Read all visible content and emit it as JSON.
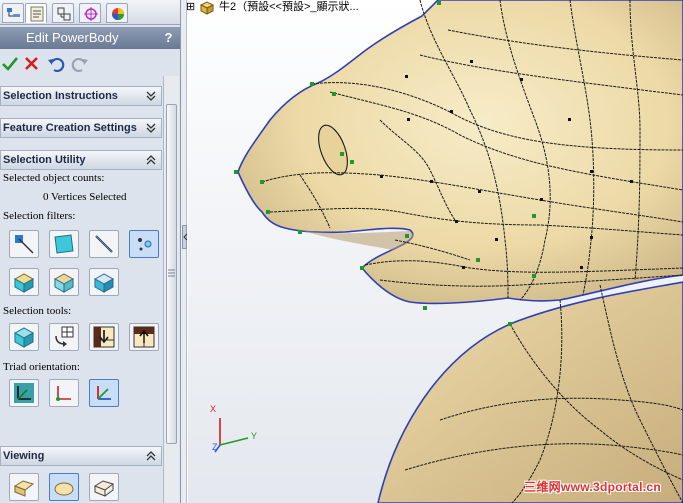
{
  "panel": {
    "title": "Edit PowerBody",
    "help_label": "?",
    "sections": {
      "selection_instructions": "Selection Instructions",
      "feature_creation_settings": "Feature Creation Settings",
      "selection_utility": "Selection Utility",
      "viewing": "Viewing"
    },
    "selected_object_counts_label": "Selected object counts:",
    "vertices_selected": "0 Vertices Selected",
    "selection_filters_label": "Selection filters:",
    "selection_tools_label": "Selection tools:",
    "triad_orientation_label": "Triad orientation:"
  },
  "tree": {
    "expander": "⊞",
    "item_label": "牛2（預設<<預設>_顯示狀..."
  },
  "triad": {
    "x": "X",
    "y": "Y",
    "z": "Z"
  },
  "watermark": "三维网www.3dportal.cn",
  "colors": {
    "surface": "#f3e5bd",
    "surface_shade": "#c9b284",
    "edge_outline": "#2f3fb8",
    "mesh_line": "#1a1a1a",
    "vertex_green": "#1e9a2a",
    "panel_bg": "#dde3ec",
    "title_bar": "#7b8aa4",
    "watermark": "#e03030"
  }
}
